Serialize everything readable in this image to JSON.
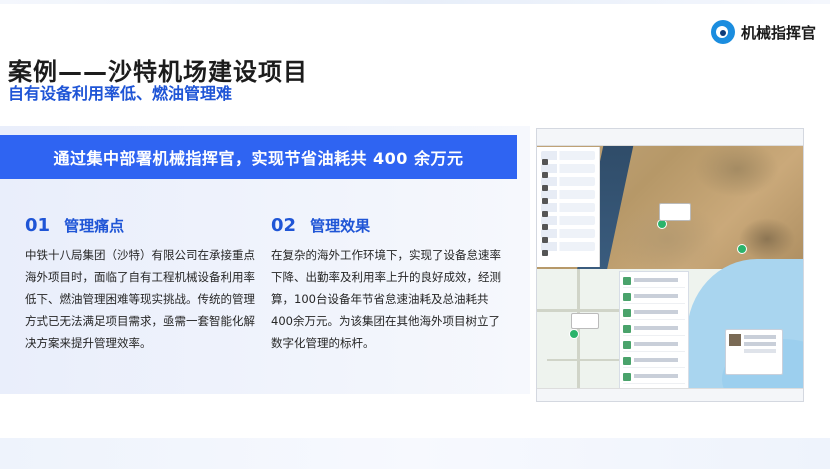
{
  "brand": {
    "name": "机械指挥官",
    "logo": "eye-logo-icon"
  },
  "title": "案例——沙特机场建设项目",
  "subtitle": "自有设备利用率低、燃油管理难",
  "banner": "通过集中部署机械指挥官，实现节省油耗共 400 余万元",
  "sections": [
    {
      "number": "01",
      "heading": "管理痛点",
      "body": "中铁十八局集团（沙特）有限公司在承接重点海外项目时，面临了自有工程机械设备利用率低下、燃油管理困难等现实挑战。传统的管理方式已无法满足项目需求，亟需一套智能化解决方案来提升管理效率。"
    },
    {
      "number": "02",
      "heading": "管理效果",
      "body": "在复杂的海外工作环境下，实现了设备怠速率下降、出勤率及利用率上升的良好成效，经测算，100台设备年节省怠速油耗及总油耗共400余万元。为该集团在其他海外项目树立了数字化管理的标杆。"
    }
  ],
  "colors": {
    "accent": "#1f55d6",
    "banner": "#2f64f2"
  }
}
